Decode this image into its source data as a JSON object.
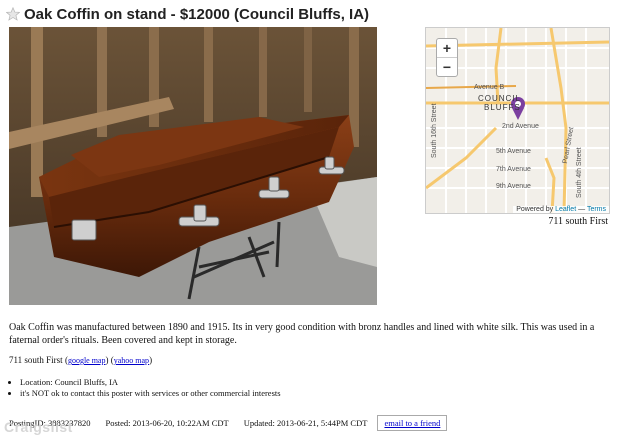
{
  "header": {
    "title": "Oak Coffin on stand - $12000 (Council Bluffs, IA)"
  },
  "map": {
    "zoom_in": "+",
    "zoom_out": "−",
    "labels": {
      "avenue_b": "Avenue B",
      "council": "COUNCIL",
      "bluffs": "BLUFFS",
      "second_ave": "2nd Avenue",
      "fifth_ave": "5th Avenue",
      "seventh_ave": "7th Avenue",
      "ninth_ave": "9th Avenue",
      "s16th": "South 16th Street",
      "s4th": "South 4th Street",
      "pearl": "Pearl Street"
    },
    "attribution_prefix": "Powered by",
    "attribution_leaflet": "Leaflet",
    "attribution_sep": "—",
    "attribution_terms": "Terms",
    "address": "711 south First"
  },
  "description": "Oak Coffin was manufactured between 1890 and 1915. Its in very good condition with bronz handles and lined with white silk. This was used in a faternal order's rituals. Been covered and kept in storage.",
  "address_line": {
    "address": "711 south First",
    "google_link": "google map",
    "yahoo_link": "yahoo map"
  },
  "bullets": [
    "Location: Council Bluffs, IA",
    "it's NOT ok to contact this poster with services or other commercial interests"
  ],
  "footer": {
    "posting_id": "PostingID: 3883237820",
    "posted": "Posted: 2013-06-20, 10:22AM CDT",
    "updated": "Updated: 2013-06-21, 5:44PM CDT",
    "email_button": "email to a friend"
  },
  "watermark": "Craigslist",
  "colors": {
    "link": "#0000cc",
    "map_marker": "#7b3fa0",
    "road_major": "#f6c86e"
  }
}
